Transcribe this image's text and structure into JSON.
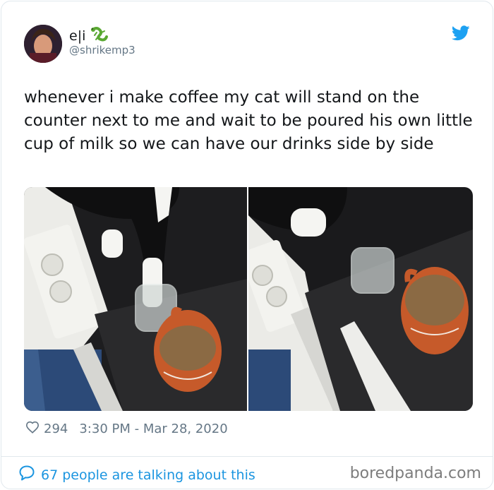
{
  "author": {
    "name": "e|i",
    "emoji_icon": "lizard-icon",
    "handle": "@shrikemp3"
  },
  "tweet": {
    "text": "whenever i make coffee my cat will stand on the counter next to me and wait to be poured his own little cup of milk so we can have our drinks side by side"
  },
  "meta": {
    "likes": "294",
    "timestamp": "3:30 PM - Mar 28, 2020"
  },
  "footer": {
    "talking": "67 people are talking about this",
    "watermark": "boredpanda.com"
  },
  "colors": {
    "twitter_blue": "#1da1f2",
    "link_blue": "#1b95e0",
    "text": "#14171a",
    "muted": "#657786"
  }
}
